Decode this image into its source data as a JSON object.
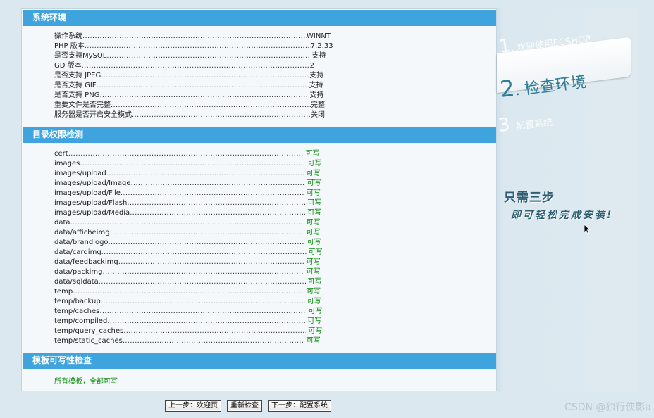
{
  "sections": {
    "env": "系统环境",
    "dir": "目录权限检测",
    "tpl": "模板可写性检查"
  },
  "env_rows": [
    {
      "label": "操作系统",
      "value": "WINNT"
    },
    {
      "label": "PHP 版本",
      "value": "7.2.33"
    },
    {
      "label": "是否支持MySQL",
      "value": "支持"
    },
    {
      "label": "GD 版本",
      "value": "2"
    },
    {
      "label": "是否支持 JPEG",
      "value": "支持"
    },
    {
      "label": "是否支持 GIF",
      "value": "支持"
    },
    {
      "label": "是否支持 PNG",
      "value": "支持"
    },
    {
      "label": "重要文件是否完整",
      "value": "完整"
    },
    {
      "label": "服务器是否开启安全模式",
      "value": "关闭"
    }
  ],
  "dir_rows": [
    {
      "label": "cert",
      "value": "可写"
    },
    {
      "label": "images",
      "value": "可写"
    },
    {
      "label": "images/upload",
      "value": "可写"
    },
    {
      "label": "images/upload/Image",
      "value": "可写"
    },
    {
      "label": "images/upload/File",
      "value": "可写"
    },
    {
      "label": "images/upload/Flash",
      "value": "可写"
    },
    {
      "label": "images/upload/Media",
      "value": "可写"
    },
    {
      "label": "data",
      "value": "可写"
    },
    {
      "label": "data/afficheimg",
      "value": "可写"
    },
    {
      "label": "data/brandlogo",
      "value": "可写"
    },
    {
      "label": "data/cardimg",
      "value": "可写"
    },
    {
      "label": "data/feedbackimg",
      "value": "可写"
    },
    {
      "label": "data/packimg",
      "value": "可写"
    },
    {
      "label": "data/sqldata",
      "value": "可写"
    },
    {
      "label": "temp",
      "value": "可写"
    },
    {
      "label": "temp/backup",
      "value": "可写"
    },
    {
      "label": "temp/caches",
      "value": "可写"
    },
    {
      "label": "temp/compiled",
      "value": "可写"
    },
    {
      "label": "temp/query_caches",
      "value": "可写"
    },
    {
      "label": "temp/static_caches",
      "value": "可写"
    }
  ],
  "tpl_result": "所有模板，全部可写",
  "buttons": {
    "prev": "上一步：欢迎页",
    "recheck": "重新检查",
    "next": "下一步：配置系统"
  },
  "steps": [
    {
      "num": "1",
      "label": ". 欢迎使用ECSHOP"
    },
    {
      "num": "2",
      "label": ". 检查环境"
    },
    {
      "num": "3",
      "label": ". 配置系统"
    }
  ],
  "tagline1": "只需三步",
  "tagline2": "即可轻松完成安装!",
  "watermark": "CSDN @独行侠影a",
  "colors": {
    "header": "#3fa3dd",
    "ok": "#0a8a0a",
    "active_step": "#2f7c97"
  },
  "icons": {
    "cursor": "mouse-pointer-icon"
  }
}
